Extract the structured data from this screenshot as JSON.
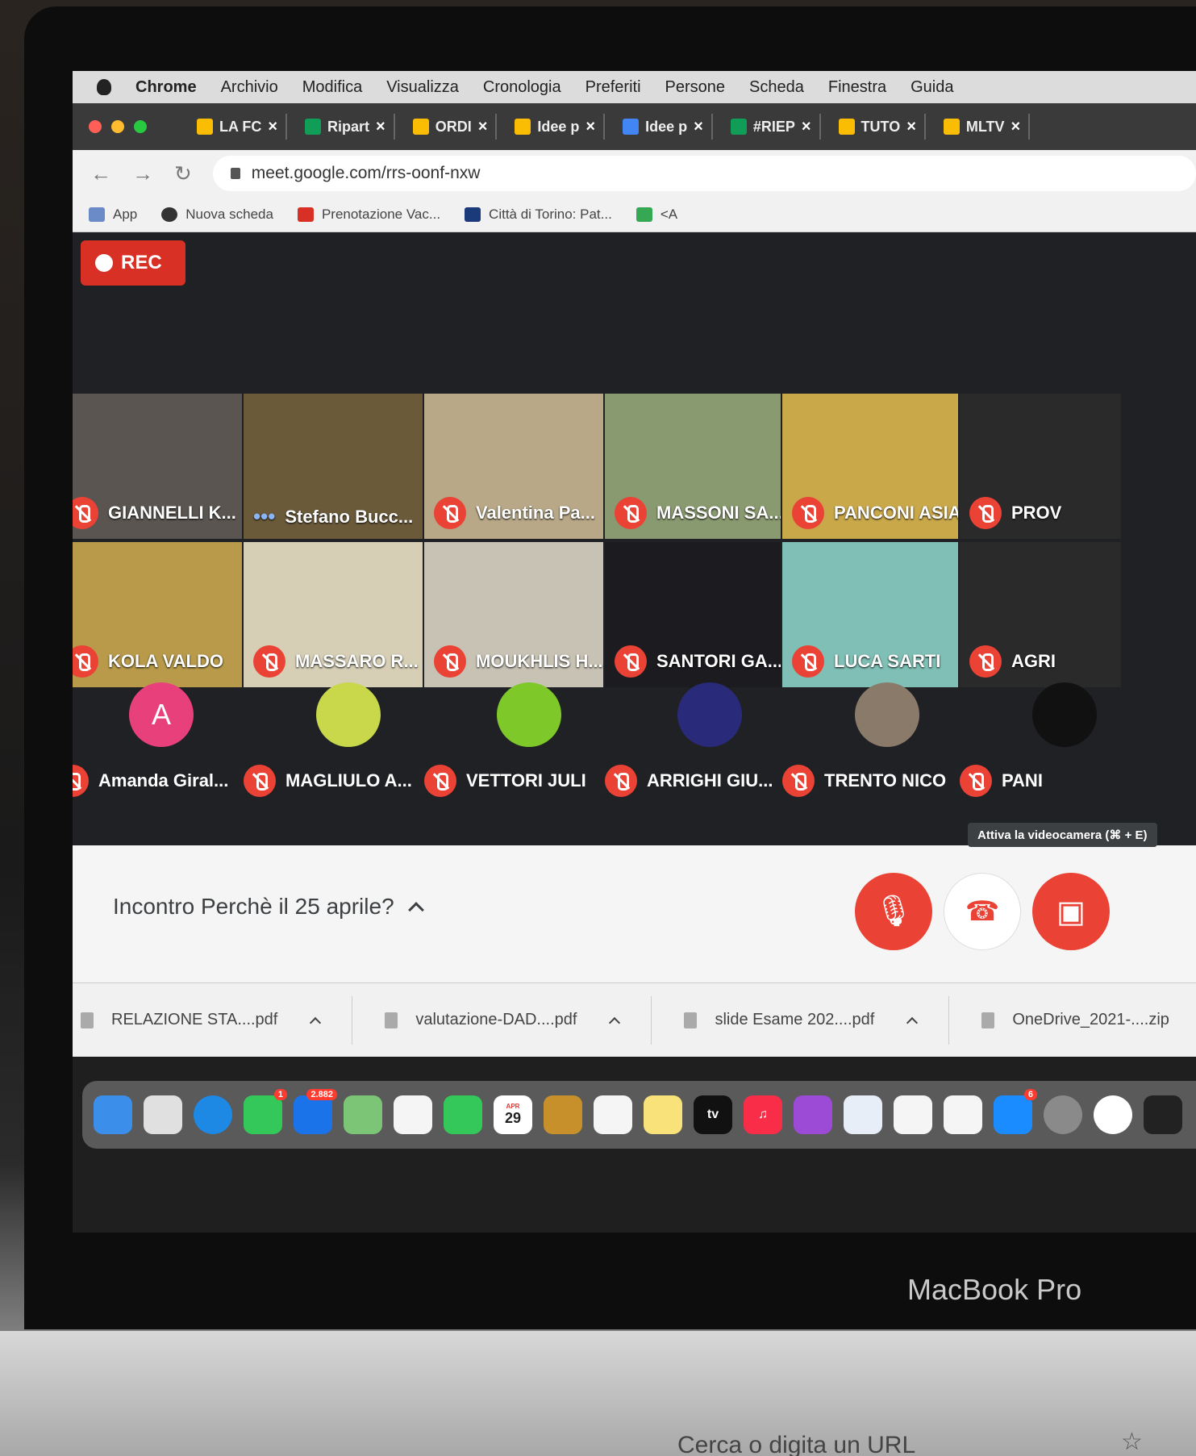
{
  "menubar": {
    "items": [
      "Chrome",
      "Archivio",
      "Modifica",
      "Visualizza",
      "Cronologia",
      "Preferiti",
      "Persone",
      "Scheda",
      "Finestra",
      "Guida"
    ]
  },
  "tabs": [
    {
      "label": "LA FC",
      "color": "#fbbc04"
    },
    {
      "label": "Ripart",
      "color": "#0f9d58"
    },
    {
      "label": "ORDI",
      "color": "#fbbc04"
    },
    {
      "label": "Idee p",
      "color": "#fbbc04"
    },
    {
      "label": "Idee p",
      "color": "#4285f4"
    },
    {
      "label": "#RIEP",
      "color": "#0f9d58"
    },
    {
      "label": "TUTO",
      "color": "#fbbc04"
    },
    {
      "label": "MLTV",
      "color": "#fbbc04"
    }
  ],
  "address": {
    "url": "meet.google.com/rrs-oonf-nxw"
  },
  "bookmarks": [
    "App",
    "Nuova scheda",
    "Prenotazione Vac...",
    "Città di Torino: Pat...",
    "<A"
  ],
  "meet": {
    "rec_label": "REC",
    "video_tiles": [
      {
        "name": "GIANNELLI K...",
        "bg": "#5a5550",
        "muted": true
      },
      {
        "name": "Stefano Bucc...",
        "bg": "#6b5a3a",
        "muted": false
      },
      {
        "name": "Valentina Pa...",
        "bg": "#b8a887",
        "muted": true
      },
      {
        "name": "MASSONI SA...",
        "bg": "#8a9a70",
        "muted": true
      },
      {
        "name": "PANCONI ASIA",
        "bg": "#c9a84a",
        "muted": true
      },
      {
        "name": "PROV",
        "bg": "#2a2a2a",
        "muted": true
      },
      {
        "name": "KOLA VALDO",
        "bg": "#b89a4a",
        "muted": true
      },
      {
        "name": "MASSARO R...",
        "bg": "#d6cfb6",
        "muted": true
      },
      {
        "name": "MOUKHLIS H...",
        "bg": "#c8c2b4",
        "muted": true
      },
      {
        "name": "SANTORI GA...",
        "bg": "#1c1c20",
        "muted": true
      },
      {
        "name": "LUCA SARTI",
        "bg": "#7fbfb5",
        "muted": true
      },
      {
        "name": "AGRI",
        "bg": "#2a2a2a",
        "muted": true
      }
    ],
    "avatar_tiles": [
      {
        "name": "Amanda Giral...",
        "initial": "A",
        "color": "#e8407a"
      },
      {
        "name": "MAGLIULO A...",
        "initial": "",
        "color": "#c8d84a"
      },
      {
        "name": "VETTORI JULI",
        "initial": "",
        "color": "#7ec82a"
      },
      {
        "name": "ARRIGHI GIU...",
        "initial": "",
        "color": "#2a2a7a"
      },
      {
        "name": "TRENTO NICO",
        "initial": "",
        "color": "#8a7a6a"
      },
      {
        "name": "PANI",
        "initial": "",
        "color": "#111111"
      }
    ],
    "meeting_title": "Incontro Perchè il 25 aprile?",
    "tooltip": "Attiva la videocamera (⌘ + E)"
  },
  "downloads": [
    "RELAZIONE STA....pdf",
    "valutazione-DAD....pdf",
    "slide Esame 202....pdf",
    "OneDrive_2021-....zip"
  ],
  "dock": {
    "messages_badge": "1",
    "mail_badge": "2.882",
    "calendar_month": "APR",
    "calendar_day": "29",
    "tv_label": "tv",
    "appstore_badge": "6"
  },
  "device": {
    "brand": "MacBook Pro",
    "touchbar_text": "Cerca o digita un URL"
  }
}
